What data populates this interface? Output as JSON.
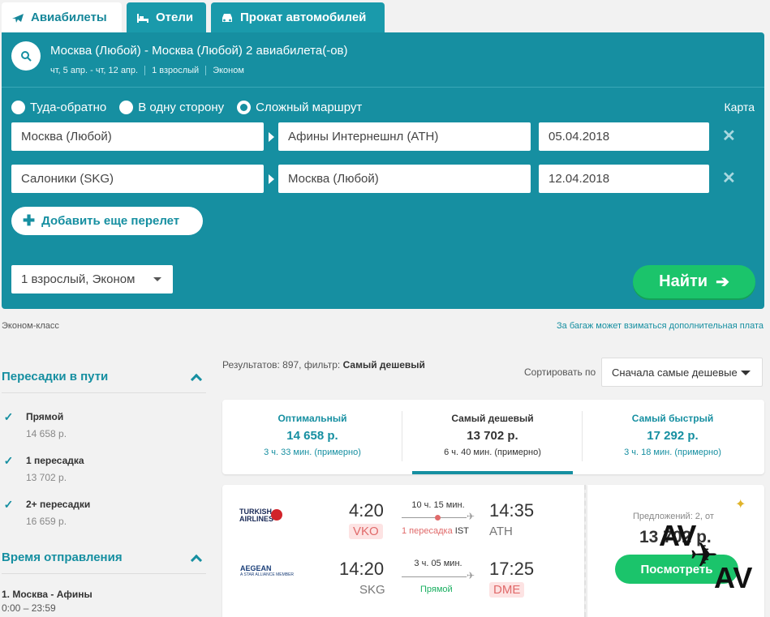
{
  "tabs": [
    {
      "label": "Авиабилеты",
      "icon": "plane-icon"
    },
    {
      "label": "Отели",
      "icon": "bed-icon"
    },
    {
      "label": "Прокат автомобилей",
      "icon": "car-icon"
    }
  ],
  "summary": {
    "title": "Москва (Любой) - Москва (Любой) 2 авиабилета(-ов)",
    "dates": "чт, 5 апр. - чт, 12 апр.",
    "pax": "1 взрослый",
    "class": "Эконом"
  },
  "trip_types": [
    {
      "label": "Туда-обратно",
      "selected": false
    },
    {
      "label": "В одну сторону",
      "selected": false
    },
    {
      "label": "Сложный маршрут",
      "selected": true
    }
  ],
  "map_label": "Карта",
  "legs": [
    {
      "from": "Москва (Любой)",
      "to": "Афины Интернешнл (ATH)",
      "date": "05.04.2018"
    },
    {
      "from": "Салоники (SKG)",
      "to": "Москва (Любой)",
      "date": "12.04.2018"
    }
  ],
  "add_flight_label": "Добавить еще перелет",
  "pax_select": "1 взрослый, Эконом",
  "find_label": "Найти",
  "econ_class_label": "Эконом-класс",
  "baggage_note": "За багаж может взиматься дополнительная плата",
  "filters": {
    "stops_title": "Пересадки в пути",
    "stops_options": [
      {
        "label": "Прямой",
        "price": "14 658 р."
      },
      {
        "label": "1 пересадка",
        "price": "13 702 р."
      },
      {
        "label": "2+ пересадки",
        "price": "16 659 р."
      }
    ],
    "departure_title": "Время отправления",
    "departure_route": "1. Москва - Афины",
    "departure_range": "0:00 – 23:59"
  },
  "results": {
    "prefix": "Результатов: 897, фильтр:",
    "filter": "Самый дешевый",
    "sort_label": "Сортировать по",
    "sort_value": "Сначала самые дешевые"
  },
  "sort_tabs": [
    {
      "title": "Оптимальный",
      "price": "14 658 р.",
      "duration": "3 ч. 33 мин. (примерно)",
      "active": false
    },
    {
      "title": "Самый дешевый",
      "price": "13 702 р.",
      "duration": "6 ч. 40 мин. (примерно)",
      "active": true
    },
    {
      "title": "Самый быстрый",
      "price": "17 292 р.",
      "duration": "3 ч. 18 мин. (примерно)",
      "active": false
    }
  ],
  "flight": {
    "segments": [
      {
        "airline_line1": "TURKISH",
        "airline_line2": "AIRLINES",
        "dep_time": "4:20",
        "dep_code": "VKO",
        "duration": "10 ч. 15 мин.",
        "stops_red": "1 пересадка",
        "stops_via": "IST",
        "arr_time": "14:35",
        "arr_code": "ATH"
      },
      {
        "airline_line1": "AEGEAN",
        "airline_line2": "A STAR ALLIANCE MEMBER",
        "dep_time": "14:20",
        "dep_code": "SKG",
        "duration": "3 ч. 05 мин.",
        "stops_red": "",
        "stops_via": "Прямой",
        "arr_time": "17:25",
        "arr_code": "DME"
      }
    ],
    "offers": "Предложений: 2, от",
    "price": "13 702 р.",
    "view_label": "Посмотреть"
  },
  "watermark": {
    "top": "AV",
    "bottom": "AV"
  },
  "colors": {
    "brand": "#168fa1",
    "accent_green": "#1bc46b",
    "warn": "#e06a6a"
  }
}
